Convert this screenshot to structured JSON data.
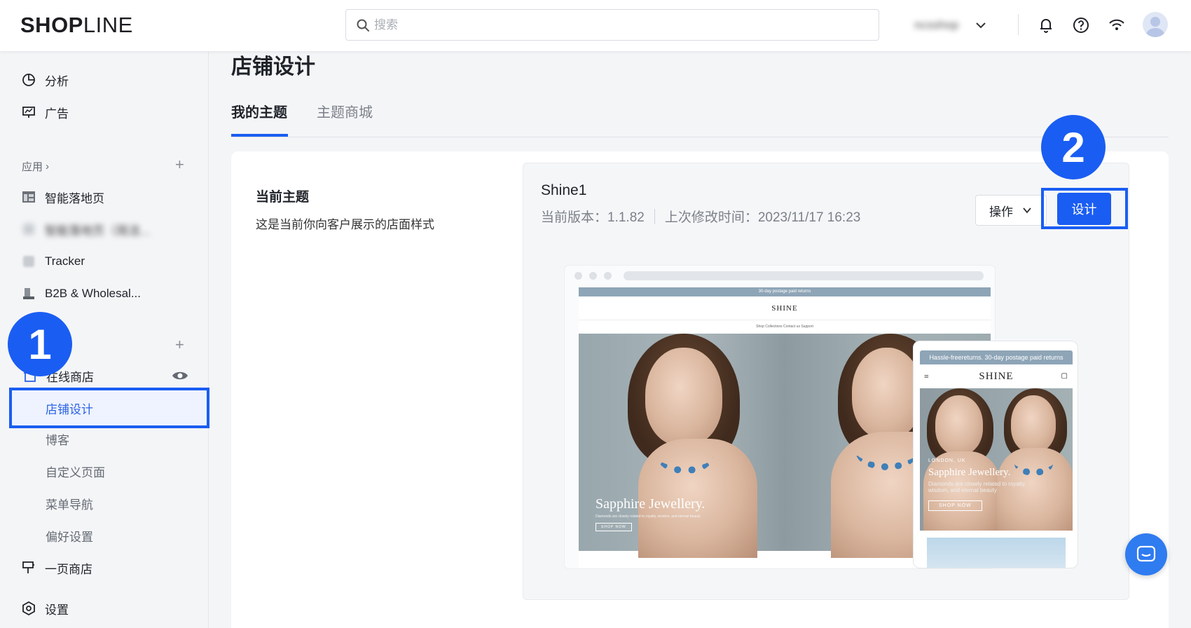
{
  "topbar": {
    "logo_bold": "SHOP",
    "logo_light": "LINE",
    "search_placeholder": "搜索",
    "store_name": "ncsshop",
    "icons": [
      "bell-icon",
      "help-icon",
      "wifi-icon",
      "avatar"
    ]
  },
  "sidebar": {
    "items": [
      {
        "label": "分析",
        "icon": "analytics-icon"
      },
      {
        "label": "广告",
        "icon": "ads-icon"
      }
    ],
    "apps_label": "应用",
    "apps": [
      {
        "label": "智能落地页",
        "icon": "landing-page-icon"
      },
      {
        "label": "智能落地页（简洁...",
        "icon": "app-icon"
      },
      {
        "label": "Tracker",
        "icon": "tracker-icon"
      },
      {
        "label": "B2B & Wholesal...",
        "icon": "b2b-icon"
      }
    ],
    "online_store": "在线商店",
    "sub_items": {
      "store_design": "店铺设计",
      "blog": "博客",
      "custom_pages": "自定义页面",
      "menu_nav": "菜单导航",
      "preferences": "偏好设置"
    },
    "one_page_store": "一页商店",
    "settings": "设置"
  },
  "annotations": {
    "step1": "1",
    "step2": "2"
  },
  "main": {
    "page_title": "店铺设计",
    "tabs": [
      {
        "label": "我的主题",
        "active": true
      },
      {
        "label": "主题商城",
        "active": false
      }
    ],
    "current_theme_title": "当前主题",
    "current_theme_desc": "这是当前你向客户展示的店面样式",
    "theme": {
      "name": "Shine1",
      "version": "当前版本：1.1.82",
      "modified": "上次修改时间：2023/11/17 16:23",
      "ops_label": "操作",
      "design_label": "设计"
    },
    "preview": {
      "desktop_announce": "30-day postage paid returns",
      "brand": "SHINE",
      "nav": "Shop    Collections    Contact us    Support",
      "hero_title": "Sapphire Jewellery.",
      "hero_sub": "Diamonds are closely related to royalty, wisdom, and eternal beauty",
      "hero_btn": "SHOP NOW",
      "mobile_announce": "Hassle-freereturns. 30-day postage paid returns",
      "mobile_location": "LONDON, UK",
      "mobile_sub": "Diamonds are closely related to royalty, wisdom, and eternal beauty",
      "mobile_btn": "SHOP NOW"
    }
  },
  "colors": {
    "accent": "#1a5df2",
    "active_text": "#2b62e3",
    "chat": "#2f7bf0"
  }
}
